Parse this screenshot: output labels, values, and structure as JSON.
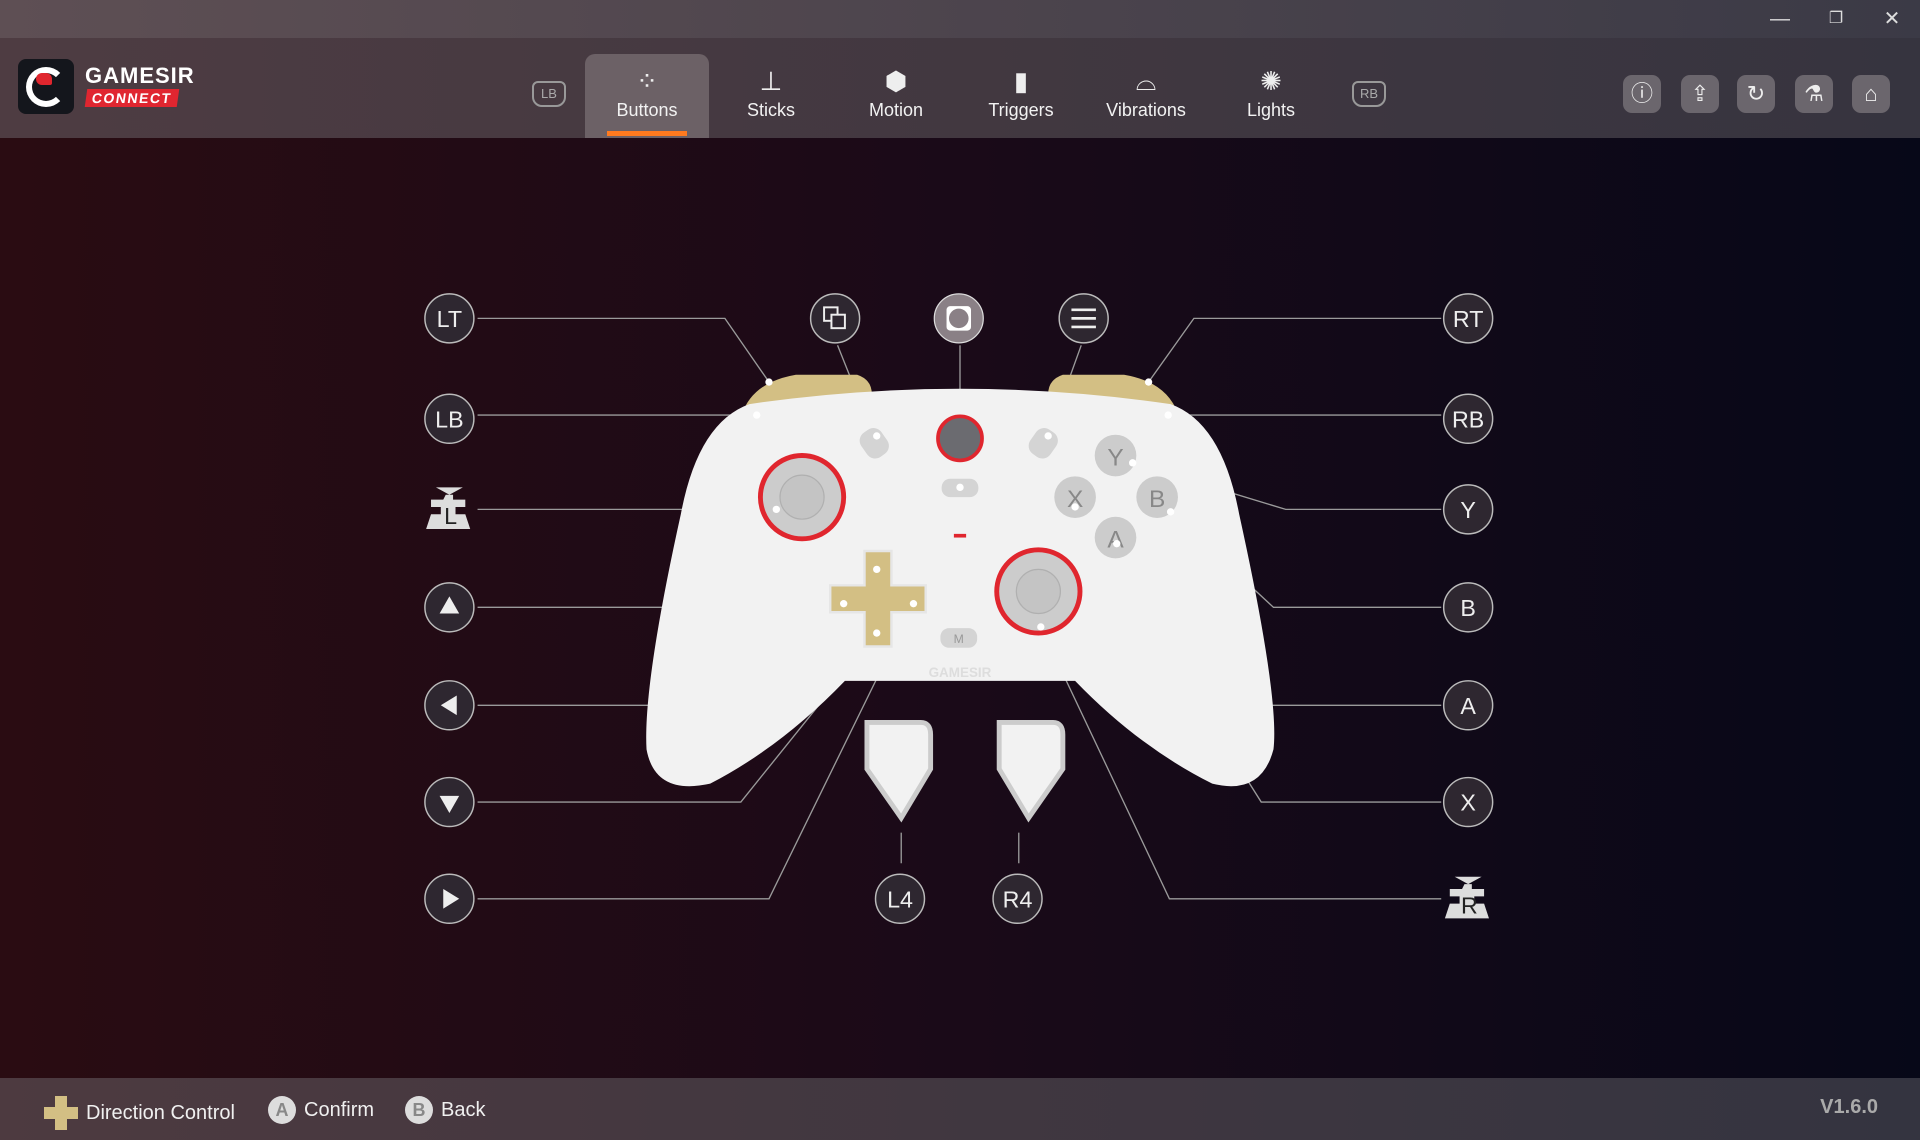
{
  "window": {
    "minimize": "—",
    "restore": "❐",
    "close": "✕"
  },
  "brand": {
    "name": "GAMESIR",
    "sub": "CONNECT"
  },
  "tabs": {
    "left_bumper": "LB",
    "right_bumper": "RB",
    "items": [
      {
        "label": "Buttons",
        "icon": "gamepad-buttons-icon",
        "active": true
      },
      {
        "label": "Sticks",
        "icon": "stick-icon"
      },
      {
        "label": "Motion",
        "icon": "cube-icon"
      },
      {
        "label": "Triggers",
        "icon": "trigger-icon"
      },
      {
        "label": "Vibrations",
        "icon": "controller-vibration-icon"
      },
      {
        "label": "Lights",
        "icon": "bulb-icon"
      }
    ]
  },
  "header_actions": [
    "info-icon",
    "upload-icon",
    "reset-icon",
    "flask-icon",
    "home-icon"
  ],
  "callouts": {
    "lt": "LT",
    "lb": "LB",
    "rt": "RT",
    "rb": "RB",
    "y": "Y",
    "b": "B",
    "a": "A",
    "x": "X",
    "l4": "L4",
    "r4": "R4",
    "ls": "L",
    "rs": "R",
    "gamesir_logo": "GAMESIR",
    "m": "M"
  },
  "controller": {
    "body_color": "#f2f2f2",
    "accent_gold": "#d3bf84",
    "ring_red": "#e0262e"
  },
  "footer": {
    "direction": "Direction Control",
    "confirm_key": "A",
    "confirm": "Confirm",
    "back_key": "B",
    "back": "Back",
    "version": "V1.6.0"
  },
  "colors": {
    "active_tab_underline": "#ff7a1f",
    "brand_red": "#e02630"
  }
}
